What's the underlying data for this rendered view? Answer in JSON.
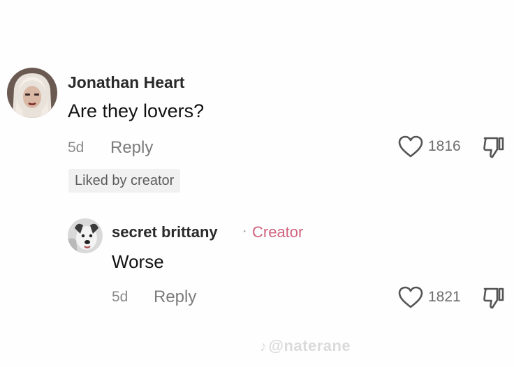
{
  "comments": [
    {
      "username": "Jonathan Heart",
      "text": "Are they lovers?",
      "time": "5d",
      "reply_label": "Reply",
      "likes": "1816",
      "badge": "Liked by creator"
    }
  ],
  "reply": {
    "username": "secret brittany",
    "separator": "·",
    "tag": "Creator",
    "text": "Worse",
    "time": "5d",
    "reply_label": "Reply",
    "likes": "1821"
  },
  "watermark": {
    "logo": "♪",
    "handle": "@naterane"
  },
  "icons": {
    "like": "heart-outline-icon",
    "dislike": "thumbs-down-icon"
  },
  "colors": {
    "creator_tag": "#d0637f",
    "secondary_text": "#7b7b7b"
  }
}
